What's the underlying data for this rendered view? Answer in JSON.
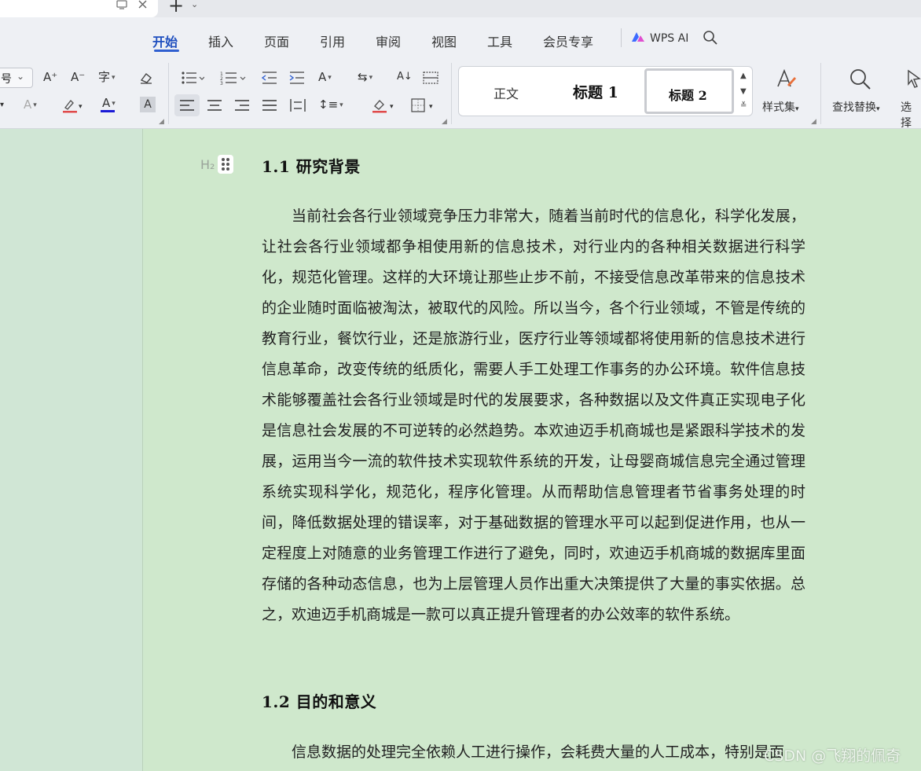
{
  "tab_actions": {
    "new_tab": "+",
    "menu": "⌄"
  },
  "menu": {
    "items": [
      "开始",
      "插入",
      "页面",
      "引用",
      "审阅",
      "视图",
      "工具",
      "会员专享"
    ],
    "ai_label": "WPS AI"
  },
  "toolbar": {
    "font_size_value": "号",
    "increase_font": "A⁺",
    "decrease_font": "A⁻",
    "phonetic_guide": "字",
    "styles": {
      "normal": "正文",
      "heading1": "标题 1",
      "heading2": "标题 2"
    },
    "style_set_label": "样式集",
    "find_replace_label": "查找替换",
    "select_label": "选择"
  },
  "document": {
    "heading_marker": "H₂",
    "section1": {
      "heading": "1.1  研究背景",
      "paragraph": "当前社会各行业领域竞争压力非常大，随着当前时代的信息化，科学化发展，让社会各行业领域都争相使用新的信息技术，对行业内的各种相关数据进行科学化，规范化管理。这样的大环境让那些止步不前，不接受信息改革带来的信息技术的企业随时面临被淘汰，被取代的风险。所以当今，各个行业领域，不管是传统的教育行业，餐饮行业，还是旅游行业，医疗行业等领域都将使用新的信息技术进行信息革命，改变传统的纸质化，需要人手工处理工作事务的办公环境。软件信息技术能够覆盖社会各行业领域是时代的发展要求，各种数据以及文件真正实现电子化是信息社会发展的不可逆转的必然趋势。本欢迪迈手机商城也是紧跟科学技术的发展，运用当今一流的软件技术实现软件系统的开发，让母婴商城信息完全通过管理系统实现科学化，规范化，程序化管理。从而帮助信息管理者节省事务处理的时间，降低数据处理的错误率，对于基础数据的管理水平可以起到促进作用，也从一定程度上对随意的业务管理工作进行了避免，同时，欢迪迈手机商城的数据库里面存储的各种动态信息，也为上层管理人员作出重大决策提供了大量的事实依据。总之，欢迪迈手机商城是一款可以真正提升管理者的办公效率的软件系统。"
    },
    "section2": {
      "heading": "1.2  目的和意义",
      "paragraph": "信息数据的处理完全依赖人工进行操作，会耗费大量的人工成本，特别是面"
    }
  },
  "watermark": "CSDN @飞翔的佩奇",
  "colors": {
    "accent": "#2f5fd0",
    "page_background": "#cfe8cc",
    "toolbar_background": "#eef0f4"
  }
}
